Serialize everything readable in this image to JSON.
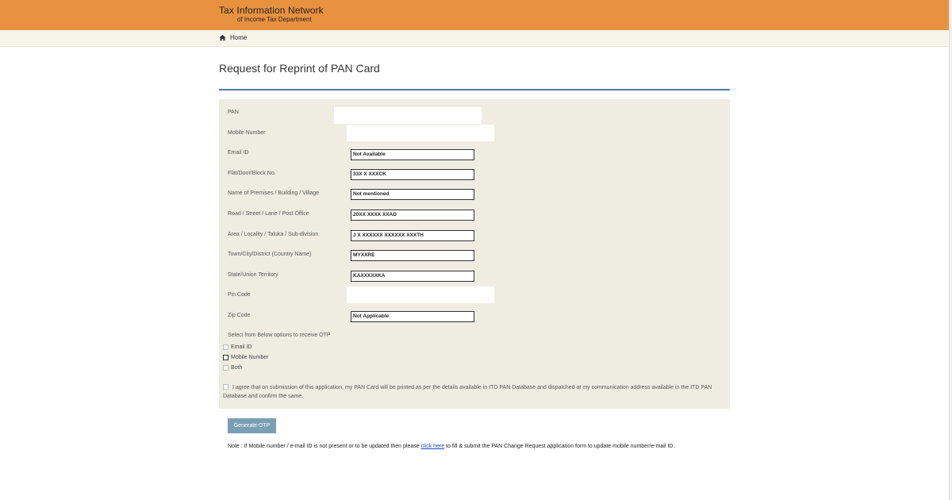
{
  "header": {
    "brand_line1": "Tax Information Network",
    "brand_line2": "of Income Tax Department",
    "bg_color": "#e8923f"
  },
  "breadcrumb": {
    "home": "Home",
    "icon": "home-icon"
  },
  "page": {
    "title": "Request for Reprint of PAN Card"
  },
  "form": {
    "pan": {
      "label": "PAN",
      "value": ""
    },
    "mobile": {
      "label": "Mobile Number",
      "value": ""
    },
    "email": {
      "label": "Email ID",
      "value": "Not Available"
    },
    "flat": {
      "label": "Flat/Door/Block No.",
      "value": "33X X XXXCK"
    },
    "premises": {
      "label": "Name of Premises / Building / Village",
      "value": "Not mentioned"
    },
    "road": {
      "label": "Road / Street / Lane / Post Office",
      "value": "20XX XXXX XXAD"
    },
    "area": {
      "label": "Area / Locality / Taluka / Sub-division",
      "value": "J X XXXXXX XXXXXX XXXTH"
    },
    "town": {
      "label": "Town/City/District (Country Name)",
      "value": "MYXXRE"
    },
    "state": {
      "label": "State/Union Territory",
      "value": "KAXXXXXKA"
    },
    "pin": {
      "label": "Pin Code",
      "value": ""
    },
    "zip": {
      "label": "Zip Code",
      "value": "Not Applicable"
    }
  },
  "otp": {
    "label": "Select from Below options to receive OTP",
    "options": [
      "Email ID",
      "Mobile Number",
      "Both"
    ]
  },
  "agreement": "I agree that on submission of this application, my PAN Card will be printed as per the details available in ITD PAN Database and dispatched at my communication address available in the ITD PAN Database and confirm the same.",
  "button": {
    "label": "Generate OTP"
  },
  "note": {
    "prefix": "Note : If Mobile number / e-mail ID is not present or to be updated then please",
    "link": "click here",
    "suffix": "to fill & submit the PAN Change Request application form to update mobile number/e-mail ID."
  }
}
